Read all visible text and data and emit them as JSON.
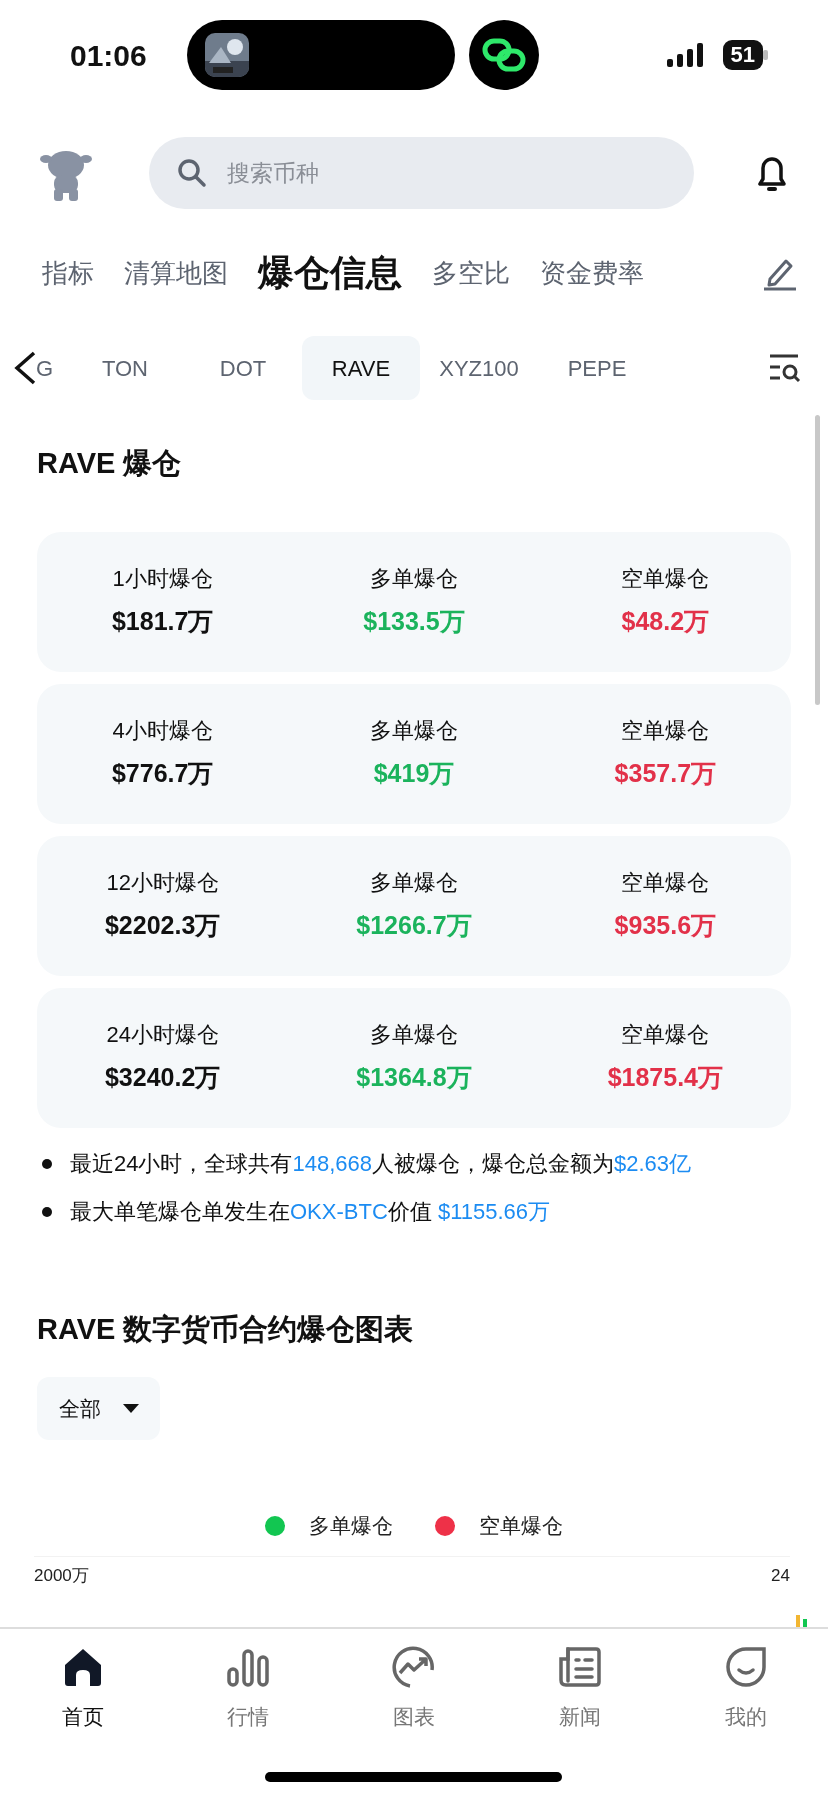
{
  "status_bar": {
    "time": "01:06",
    "battery": "51"
  },
  "search": {
    "placeholder": "搜索币种"
  },
  "category_tabs": [
    {
      "label": "指标",
      "selected": false
    },
    {
      "label": "清算地图",
      "selected": false
    },
    {
      "label": "爆仓信息",
      "selected": true
    },
    {
      "label": "多空比",
      "selected": false
    },
    {
      "label": "资金费率",
      "selected": false
    }
  ],
  "coin_tabs": [
    {
      "label": "G",
      "selected": false
    },
    {
      "label": "TON",
      "selected": false
    },
    {
      "label": "DOT",
      "selected": false
    },
    {
      "label": "RAVE",
      "selected": true
    },
    {
      "label": "XYZ100",
      "selected": false
    },
    {
      "label": "PEPE",
      "selected": false
    }
  ],
  "section_title": "RAVE 爆仓",
  "stats": [
    {
      "period": "1小时爆仓",
      "total": "$181.7万",
      "long_label": "多单爆仓",
      "long": "$133.5万",
      "short_label": "空单爆仓",
      "short": "$48.2万"
    },
    {
      "period": "4小时爆仓",
      "total": "$776.7万",
      "long_label": "多单爆仓",
      "long": "$419万",
      "short_label": "空单爆仓",
      "short": "$357.7万"
    },
    {
      "period": "12小时爆仓",
      "total": "$2202.3万",
      "long_label": "多单爆仓",
      "long": "$1266.7万",
      "short_label": "空单爆仓",
      "short": "$935.6万"
    },
    {
      "period": "24小时爆仓",
      "total": "$3240.2万",
      "long_label": "多单爆仓",
      "long": "$1364.8万",
      "short_label": "空单爆仓",
      "short": "$1875.4万"
    }
  ],
  "notes": [
    [
      {
        "text": "最近24小时，全球共有",
        "highlight": false
      },
      {
        "text": "148,668",
        "highlight": true
      },
      {
        "text": "人被爆仓，爆仓总金额为",
        "highlight": false
      },
      {
        "text": "$2.63亿",
        "highlight": true
      }
    ],
    [
      {
        "text": "最大单笔爆仓单发生在",
        "highlight": false
      },
      {
        "text": "OKX-BTC",
        "highlight": true
      },
      {
        "text": "价值 ",
        "highlight": false
      },
      {
        "text": "$1155.66万",
        "highlight": true
      }
    ]
  ],
  "chart_section": {
    "title": "RAVE 数字货币合约爆仓图表",
    "filter": "全部",
    "legend": [
      {
        "label": "多单爆仓",
        "color": "#12c651"
      },
      {
        "label": "空单爆仓",
        "color": "#ee3148"
      }
    ],
    "y_label": "2000万",
    "right_label": "24"
  },
  "bottom_nav": [
    {
      "label": "首页",
      "selected": true
    },
    {
      "label": "行情",
      "selected": false
    },
    {
      "label": "图表",
      "selected": false
    },
    {
      "label": "新闻",
      "selected": false
    },
    {
      "label": "我的",
      "selected": false
    }
  ]
}
